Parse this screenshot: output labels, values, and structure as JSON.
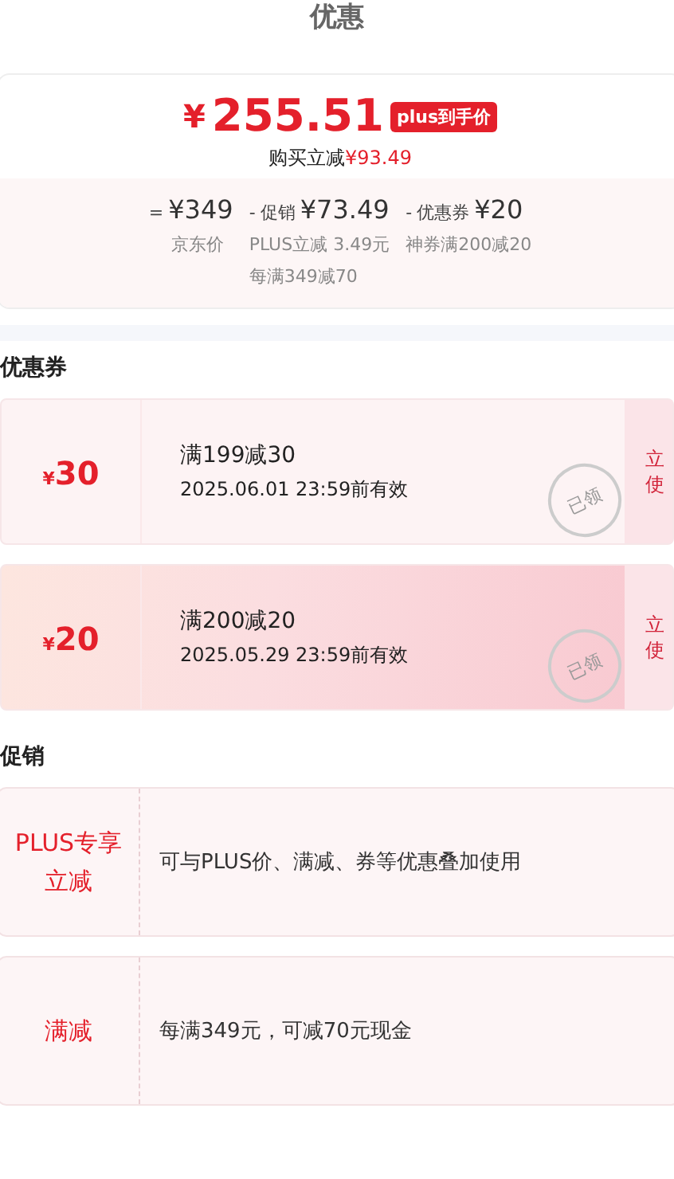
{
  "title": "优惠",
  "price_card": {
    "currency": "¥",
    "price": "255.51",
    "badge": "plus到手价",
    "saving_label": "购买立减",
    "saving": "¥93.49",
    "breakdown": [
      {
        "sign": "=",
        "amount": "¥349",
        "notes": [
          "京东价"
        ]
      },
      {
        "sign": "-",
        "label": "促销",
        "amount": "¥73.49",
        "notes": [
          "PLUS立减 3.49元",
          "每满349减70"
        ]
      },
      {
        "sign": "-",
        "label": "优惠券",
        "amount": "¥20",
        "notes": [
          "神券满200减20"
        ]
      }
    ]
  },
  "coupon_section": {
    "heading": "优惠券",
    "coupons": [
      {
        "currency": "¥",
        "amount": "30",
        "condition": "满199减30",
        "validity": "2025.06.01 23:59前有效",
        "claimed": true,
        "stamp": "已领",
        "action_lines": [
          "立",
          "使"
        ],
        "kind": "plain"
      },
      {
        "currency": "¥",
        "amount": "20",
        "condition": "满200减20",
        "validity": "2025.05.29 23:59前有效",
        "claimed": true,
        "stamp": "已领",
        "action_lines": [
          "立",
          "使"
        ],
        "kind": "gradient"
      }
    ]
  },
  "promo_section": {
    "heading": "促销",
    "promos": [
      {
        "tag": "PLUS专享立减",
        "text": "可与PLUS价、满减、券等优惠叠加使用"
      },
      {
        "tag": "满减",
        "text": "每满349元，可减70元现金"
      }
    ]
  }
}
